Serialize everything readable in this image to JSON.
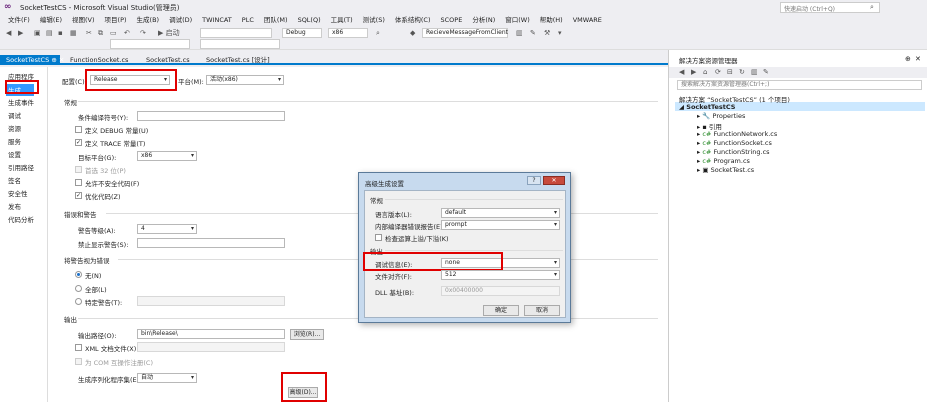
{
  "window": {
    "title": "SocketTestCS - Microsoft Visual Studio(管理员)",
    "quick_launch": "快速启动 (Ctrl+Q)"
  },
  "menu": [
    "文件(F)",
    "编辑(E)",
    "视图(V)",
    "项目(P)",
    "生成(B)",
    "调试(D)",
    "TWINCAT",
    "PLC",
    "团队(M)",
    "SQL(Q)",
    "工具(T)",
    "测试(S)",
    "体系结构(C)",
    "SCOPE",
    "分析(N)",
    "窗口(W)",
    "帮助(H)",
    "VMWARE"
  ],
  "toolbar": {
    "start_label": "▶ 启动",
    "config": "Debug",
    "platform": "x86",
    "function": "RecieveMessageFromClient"
  },
  "tabs": [
    {
      "label": "SocketTestCS",
      "active": true
    },
    {
      "label": "FunctionSocket.cs",
      "active": false
    },
    {
      "label": "SocketTest.cs",
      "active": false
    },
    {
      "label": "SocketTest.cs [设计]",
      "active": false
    }
  ],
  "nav": [
    "应用程序",
    "生成",
    "生成事件",
    "调试",
    "资源",
    "服务",
    "设置",
    "引用路径",
    "签名",
    "安全性",
    "发布",
    "代码分析"
  ],
  "config_label": "配置(C):",
  "config_value": "Release",
  "platform_label": "平台(M):",
  "platform_value": "活动(x86)",
  "general": {
    "title": "常规",
    "symbols_label": "条件编译符号(Y):",
    "define_debug": "定义 DEBUG 常量(U)",
    "define_trace": "定义 TRACE 常量(T)",
    "target_label": "目标平台(G):",
    "target_value": "x86",
    "prefer32": "首选 32 位(P)",
    "unsafe": "允许不安全代码(F)",
    "optimize": "优化代码(Z)"
  },
  "errors": {
    "title": "错误和警告",
    "warn_level_label": "警告等级(A):",
    "warn_level_value": "4",
    "suppress_label": "禁止显示警告(S):"
  },
  "treat_warnings": {
    "title": "将警告视为错误",
    "none": "无(N)",
    "all": "全部(L)",
    "specific": "特定警告(T):"
  },
  "output": {
    "title": "输出",
    "path_label": "输出路径(O):",
    "path_value": "bin\\Release\\",
    "browse": "浏览(R)...",
    "xml_doc": "XML 文档文件(X):",
    "com": "为 COM 互操作注册(C)",
    "serialization_label": "生成序列化程序集(E):",
    "serialization_value": "自动",
    "advanced": "高级(D)..."
  },
  "dialog": {
    "title": "高级生成设置",
    "help": "?",
    "close": "✕",
    "general": "常规",
    "lang_label": "语言版本(L):",
    "lang_value": "default",
    "report_label": "内部编译器错误报告(E):",
    "report_value": "prompt",
    "overflow": "检查运算上溢/下溢(K)",
    "output": "输出",
    "debug_label": "调试信息(E):",
    "debug_value": "none",
    "align_label": "文件对齐(F):",
    "align_value": "512",
    "dll_label": "DLL 基址(B):",
    "dll_value": "0x00400000",
    "ok": "确定",
    "cancel": "取消"
  },
  "solution_explorer": {
    "header": "解决方案资源管理器",
    "search": "搜索解决方案资源管理器(Ctrl+;)",
    "solution": "解决方案 “SocketTestCS” (1 个项目)",
    "project": "SocketTestCS",
    "items": [
      "Properties",
      "引用",
      "FunctionNetwork.cs",
      "FunctionSocket.cs",
      "FunctionString.cs",
      "Program.cs",
      "SocketTest.cs"
    ]
  }
}
